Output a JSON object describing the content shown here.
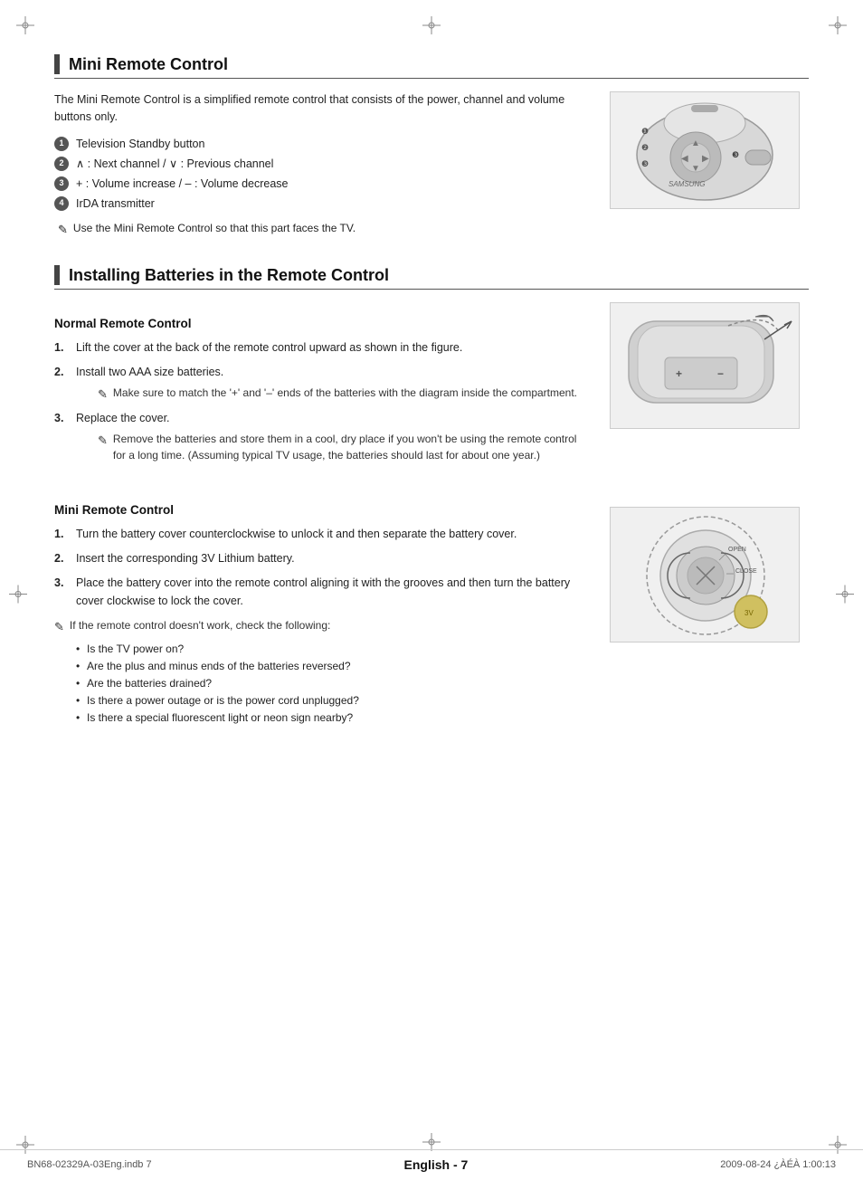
{
  "page": {
    "background": "#ffffff"
  },
  "corners": {
    "crosshair_symbol": "⊕"
  },
  "mini_remote": {
    "heading": "Mini Remote Control",
    "intro": "The Mini Remote Control is a simplified remote control that consists of the power, channel and volume buttons only.",
    "bullets": [
      {
        "num": "1",
        "text": "Television Standby button"
      },
      {
        "num": "2",
        "text": "∧ : Next channel / ∨ : Previous channel"
      },
      {
        "num": "3",
        "text": "+ : Volume increase / – : Volume decrease"
      },
      {
        "num": "4",
        "text": "IrDA transmitter"
      }
    ],
    "note": "Use the Mini Remote Control so that this part faces the TV."
  },
  "installing_batteries": {
    "heading": "Installing Batteries in the Remote Control",
    "normal_remote": {
      "sub_heading": "Normal Remote Control",
      "steps": [
        {
          "num": "1.",
          "text": "Lift the cover at the back of the remote control upward as shown in the figure."
        },
        {
          "num": "2.",
          "text": "Install two AAA size batteries.",
          "note": "Make sure to match the '+' and '–' ends of the batteries with the diagram inside the compartment."
        },
        {
          "num": "3.",
          "text": "Replace the cover.",
          "note": "Remove the batteries and store them in a cool, dry place if you won't be using the remote control for a long time. (Assuming typical TV usage, the batteries should last for about one year.)"
        }
      ]
    },
    "mini_remote": {
      "sub_heading": "Mini Remote Control",
      "steps": [
        {
          "num": "1.",
          "text": "Turn the battery cover counterclockwise to unlock it and then separate the battery cover."
        },
        {
          "num": "2.",
          "text": "Insert the corresponding 3V Lithium battery."
        },
        {
          "num": "3.",
          "text": "Place the battery cover into the remote control aligning it with the grooves and then turn the battery cover clockwise to lock the cover."
        }
      ],
      "note": "If the remote control doesn't work, check the following:",
      "checklist": [
        "Is the TV power on?",
        "Are the plus and minus ends of the batteries reversed?",
        "Are the batteries drained?",
        "Is there a power outage or is the power cord unplugged?",
        "Is there a special fluorescent light or neon sign nearby?"
      ]
    }
  },
  "footer": {
    "left": "BN68-02329A-03Eng.indb   7",
    "center": "English - 7",
    "right": "2009-08-24   ¿ÀÉÀ 1:00:13"
  }
}
